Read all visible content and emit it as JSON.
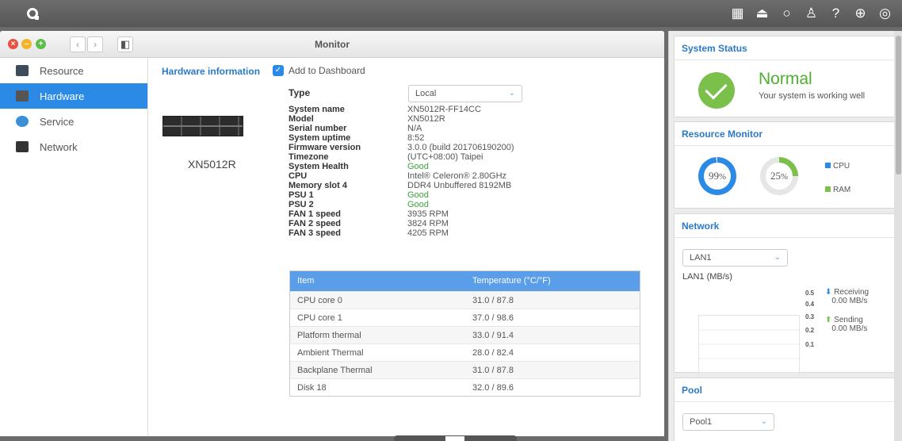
{
  "topbar": {
    "icons": [
      "apps-icon",
      "notification-icon",
      "search-icon",
      "user-icon",
      "help-icon",
      "globe-icon",
      "dashboard-icon"
    ]
  },
  "window": {
    "title": "Monitor"
  },
  "sidebar": {
    "items": [
      {
        "label": "Resource",
        "icon": "resource-icon"
      },
      {
        "label": "Hardware",
        "icon": "hardware-icon"
      },
      {
        "label": "Service",
        "icon": "service-icon"
      },
      {
        "label": "Network",
        "icon": "network-icon"
      }
    ]
  },
  "hardware": {
    "title": "Hardware information",
    "add_dashboard": "Add to Dashboard",
    "model_name": "XN5012R",
    "type_label": "Type",
    "type_value": "Local",
    "info": [
      {
        "key": "System name",
        "value": "XN5012R-FF14CC"
      },
      {
        "key": "Model",
        "value": "XN5012R"
      },
      {
        "key": "Serial number",
        "value": "N/A"
      },
      {
        "key": "System uptime",
        "value": "8:52"
      },
      {
        "key": "Firmware version",
        "value": "3.0.0 (build 201706190200)"
      },
      {
        "key": "Timezone",
        "value": "(UTC+08:00) Taipei"
      },
      {
        "key": "System Health",
        "value": "Good"
      },
      {
        "key": "CPU",
        "value": "Intel® Celeron® 2.80GHz"
      },
      {
        "key": "Memory slot 4",
        "value": "DDR4 Unbuffered 8192MB"
      },
      {
        "key": "PSU 1",
        "value": "Good"
      },
      {
        "key": "PSU 2",
        "value": "Good"
      },
      {
        "key": "FAN 1 speed",
        "value": "3935 RPM"
      },
      {
        "key": "FAN 2 speed",
        "value": "3824 RPM"
      },
      {
        "key": "FAN 3 speed",
        "value": "4205 RPM"
      }
    ],
    "table": {
      "headers": [
        "Item",
        "Temperature (°C/°F)"
      ],
      "rows": [
        [
          "CPU core 0",
          "31.0 / 87.8"
        ],
        [
          "CPU core 1",
          "37.0 / 98.6"
        ],
        [
          "Platform thermal",
          "33.0 / 91.4"
        ],
        [
          "Ambient Thermal",
          "28.0 / 82.4"
        ],
        [
          "Backplane Thermal",
          "31.0 / 87.8"
        ],
        [
          "Disk 18",
          "32.0 / 89.6"
        ]
      ]
    }
  },
  "right": {
    "status": {
      "title": "System Status",
      "state": "Normal",
      "message": "Your system is working well"
    },
    "resource": {
      "title": "Resource Monitor",
      "cpu_pct": "99",
      "ram_pct": "25",
      "cpu_label": "CPU",
      "ram_label": "RAM",
      "cpu_color": "#2a8ae6",
      "ram_color": "#7cc04c",
      "cpu_value": 0.99,
      "ram_value": 0.25
    },
    "network": {
      "title": "Network",
      "iface": "LAN1",
      "unit_label": "LAN1 (MB/s)",
      "yticks": [
        "0.5",
        "0.4",
        "0.3",
        "0.2",
        "0.1"
      ],
      "receiving_label": "Receiving",
      "receiving_value": "0.00 MB/s",
      "sending_label": "Sending",
      "sending_value": "0.00 MB/s"
    },
    "pool": {
      "title": "Pool",
      "value": "Pool1"
    }
  }
}
